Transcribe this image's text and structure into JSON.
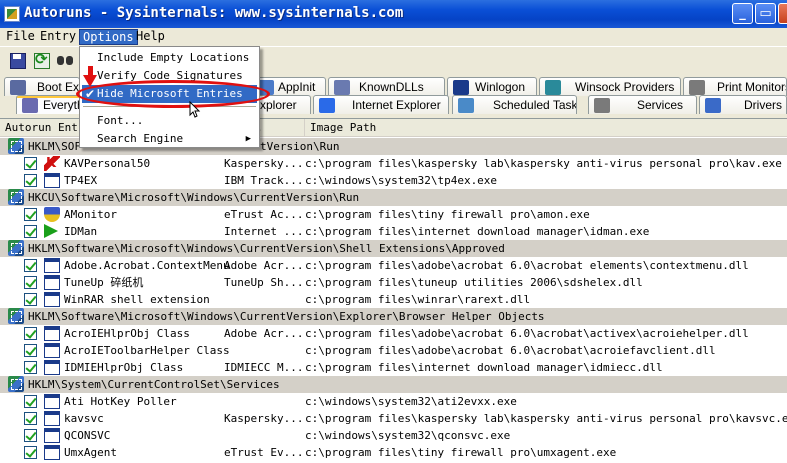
{
  "window": {
    "title": "Autoruns - Sysinternals: www.sysinternals.com",
    "min_glyph": "_",
    "max_glyph": "▭",
    "close_glyph": "×"
  },
  "menubar": {
    "file": "File",
    "entry": "Entry",
    "options": "Options",
    "help": "Help"
  },
  "options_menu": {
    "items": [
      {
        "label": "Include Empty Locations",
        "checked": false,
        "highlighted": false
      },
      {
        "label": "Verify Code Signatures",
        "checked": false,
        "highlighted": false
      },
      {
        "label": "Hide Microsoft Entries",
        "checked": true,
        "highlighted": true
      },
      {
        "label": "Font...",
        "checked": false,
        "highlighted": false
      },
      {
        "label": "Search Engine",
        "checked": false,
        "highlighted": false,
        "submenu": true
      }
    ],
    "check_glyph": "✔",
    "submenu_glyph": "▶"
  },
  "tabs_row1": [
    {
      "label": "Boot Ex",
      "icon": "boot-icon"
    },
    {
      "label": "AppInit",
      "icon": "appinit-icon"
    },
    {
      "label": "KnownDLLs",
      "icon": "knowndlls-icon"
    },
    {
      "label": "Winlogon",
      "icon": "winlogon-icon"
    },
    {
      "label": "Winsock Providers",
      "icon": "winsock-icon"
    },
    {
      "label": "Print Monitors",
      "icon": "printer-icon"
    }
  ],
  "tabs_row2": [
    {
      "label": "Everyth",
      "icon": "everything-icon",
      "selected": true
    },
    {
      "label": "xplorer",
      "icon": "explorer-icon"
    },
    {
      "label": "Internet Explorer",
      "icon": "ie-icon"
    },
    {
      "label": "Scheduled Tasks",
      "icon": "scheduled-tasks-icon"
    },
    {
      "label": "Services",
      "icon": "services-icon"
    },
    {
      "label": "Drivers",
      "icon": "drivers-icon"
    }
  ],
  "columns": {
    "entry": "Autorun Ent",
    "description": "rip...",
    "path": "Image Path"
  },
  "groups": [
    {
      "key": "HKLM\\SOF",
      "key_tail": "tVersion\\Run",
      "entries": [
        {
          "name": "KAVPersonal50",
          "desc": "Kaspersky...",
          "path": "c:\\program files\\kaspersky lab\\kaspersky anti-virus personal pro\\kav.exe",
          "icon": "kaspersky-icon"
        },
        {
          "name": "TP4EX",
          "desc": "IBM Track...",
          "path": "c:\\windows\\system32\\tp4ex.exe",
          "icon": "window-icon"
        }
      ]
    },
    {
      "key": "HKCU\\Software\\Microsoft\\Windows\\CurrentVersion\\Run",
      "key_tail": "",
      "entries": [
        {
          "name": "AMonitor",
          "desc": "eTrust Ac...",
          "path": "c:\\program files\\tiny firewall pro\\amon.exe",
          "icon": "shield-icon"
        },
        {
          "name": "IDMan",
          "desc": "Internet ...",
          "path": "c:\\program files\\internet download manager\\idman.exe",
          "icon": "play-icon"
        }
      ]
    },
    {
      "key": "HKLM\\Software\\Microsoft\\Windows\\CurrentVersion\\Shell Extensions\\Approved",
      "key_tail": "",
      "entries": [
        {
          "name": "Adobe.Acrobat.ContextMenu",
          "desc": "Adobe Acr...",
          "path": "c:\\program files\\adobe\\acrobat 6.0\\acrobat elements\\contextmenu.dll",
          "icon": "window-icon"
        },
        {
          "name": "TuneUp 碎纸机",
          "desc": "TuneUp Sh...",
          "path": "c:\\program files\\tuneup utilities 2006\\sdshelex.dll",
          "icon": "window-icon"
        },
        {
          "name": "WinRAR shell extension",
          "desc": "",
          "path": "c:\\program files\\winrar\\rarext.dll",
          "icon": "window-icon"
        }
      ]
    },
    {
      "key": "HKLM\\Software\\Microsoft\\Windows\\CurrentVersion\\Explorer\\Browser Helper Objects",
      "key_tail": "",
      "entries": [
        {
          "name": "AcroIEHlprObj Class",
          "desc": "Adobe Acr...",
          "path": "c:\\program files\\adobe\\acrobat 6.0\\acrobat\\activex\\acroiehelper.dll",
          "icon": "window-icon"
        },
        {
          "name": "AcroIEToolbarHelper Class",
          "desc": "",
          "path": "c:\\program files\\adobe\\acrobat 6.0\\acrobat\\acroiefavclient.dll",
          "icon": "window-icon"
        },
        {
          "name": "IDMIEHlprObj Class",
          "desc": "IDMIECC M...",
          "path": "c:\\program files\\internet download manager\\idmiecc.dll",
          "icon": "window-icon"
        }
      ]
    },
    {
      "key": "HKLM\\System\\CurrentControlSet\\Services",
      "key_tail": "",
      "entries": [
        {
          "name": "Ati HotKey Poller",
          "desc": "",
          "path": "c:\\windows\\system32\\ati2evxx.exe",
          "icon": "window-icon"
        },
        {
          "name": "kavsvc",
          "desc": "Kaspersky...",
          "path": "c:\\program files\\kaspersky lab\\kaspersky anti-virus personal pro\\kavsvc.exe",
          "icon": "window-icon"
        },
        {
          "name": "QCONSVC",
          "desc": "",
          "path": "c:\\windows\\system32\\qconsvc.exe",
          "icon": "window-icon"
        },
        {
          "name": "UmxAgent",
          "desc": "eTrust Ev...",
          "path": "c:\\program files\\tiny firewall pro\\umxagent.exe",
          "icon": "window-icon"
        }
      ]
    }
  ],
  "colors": {
    "titlebar": "#0a4fd6",
    "menu_highlight": "#316ac5",
    "annotation": "#e01010",
    "group_row": "#d4d0c8"
  }
}
